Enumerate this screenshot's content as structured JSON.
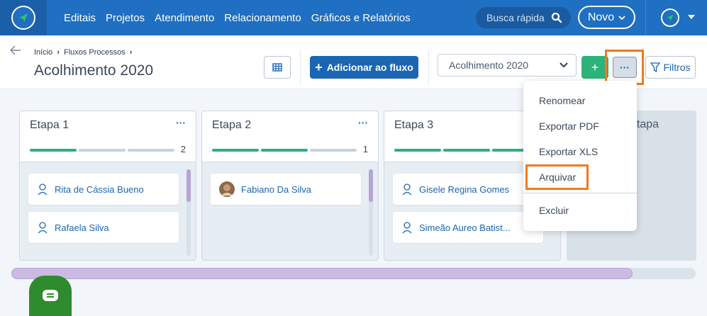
{
  "nav": {
    "links": [
      "Editais",
      "Projetos",
      "Atendimento",
      "Relacionamento",
      "Gráficos e Relatórios"
    ],
    "search_placeholder": "Busca rápida",
    "new_label": "Novo"
  },
  "header": {
    "breadcrumb": [
      "Início",
      "Fluxos Processos"
    ],
    "title": "Acolhimento 2020",
    "add_flow_label": "Adicionar ao fluxo",
    "flow_select_value": "Acolhimento 2020",
    "more_label": "···",
    "filters_label": "Filtros"
  },
  "columns": [
    {
      "title": "Etapa 1",
      "count": "2",
      "progress_done": 1,
      "progress_total": 3,
      "cards": [
        {
          "name": "Rita de Cássia Bueno"
        },
        {
          "name": "Rafaela Silva"
        }
      ]
    },
    {
      "title": "Etapa 2",
      "count": "1",
      "progress_done": 2,
      "progress_total": 3,
      "cards": [
        {
          "name": "Fabiano Da Silva"
        }
      ]
    },
    {
      "title": "Etapa 3",
      "count": "",
      "progress_done": 3,
      "progress_total": 3,
      "cards": [
        {
          "name": "Gisele Regina Gomes"
        },
        {
          "name": "Simeão Aureo Batist..."
        }
      ]
    }
  ],
  "new_column_label": "etapa",
  "dropdown": {
    "items": [
      "Renomear",
      "Exportar PDF",
      "Exportar XLS",
      "Arquivar",
      "Excluir"
    ]
  },
  "colors": {
    "nav_bg": "#1f6fc2",
    "primary": "#1a66b2",
    "success": "#2bb37a",
    "highlight": "#f07a1e"
  }
}
